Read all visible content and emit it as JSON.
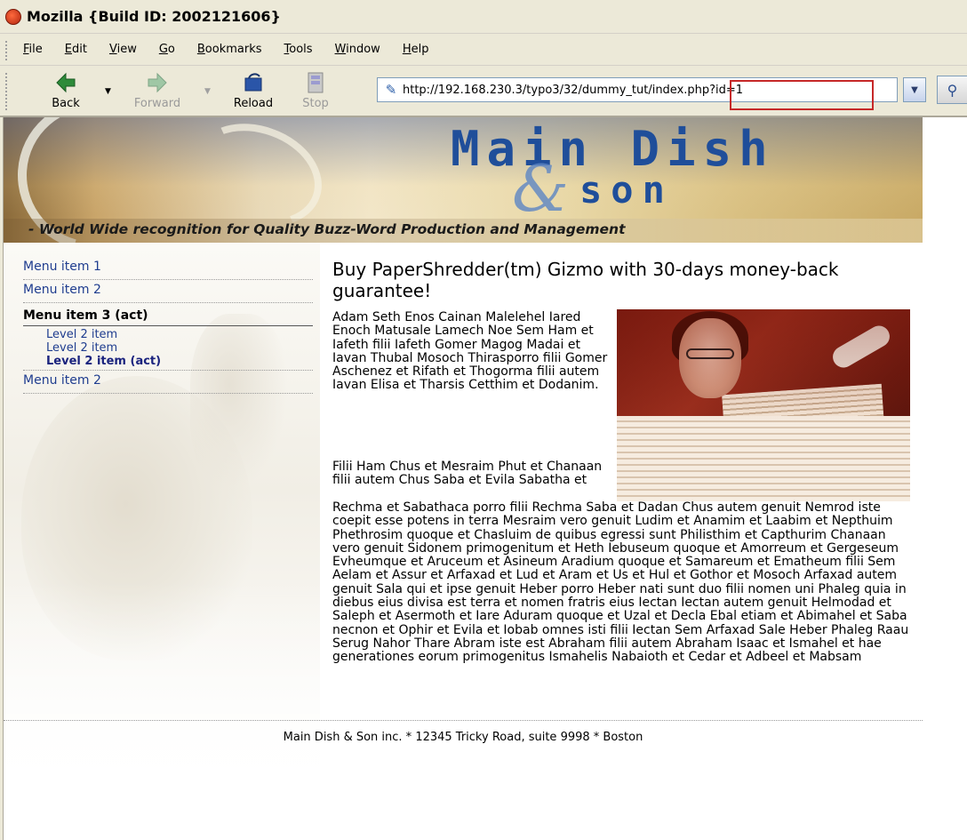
{
  "window": {
    "title": "Mozilla {Build ID: 2002121606}"
  },
  "menubar": {
    "items": [
      "File",
      "Edit",
      "View",
      "Go",
      "Bookmarks",
      "Tools",
      "Window",
      "Help"
    ]
  },
  "toolbar": {
    "back_label": "Back",
    "forward_label": "Forward",
    "reload_label": "Reload",
    "stop_label": "Stop",
    "url": "http://192.168.230.3/typo3/32/dummy_tut/index.php?id=1"
  },
  "banner": {
    "title_main": "Main Dish",
    "title_amp": "&",
    "title_son": "son",
    "tagline": "- World Wide recognition for Quality Buzz-Word Production and Management"
  },
  "menu": {
    "item1": "Menu item 1",
    "item2": "Menu item 2",
    "item3": "Menu item 3 (act)",
    "sub1": "Level 2 item",
    "sub2": "Level 2 item",
    "sub3": "Level 2 item (act)",
    "item4": "Menu item 2"
  },
  "article": {
    "heading": "Buy PaperShredder(tm) Gizmo with 30-days money-back guarantee!",
    "para1": "Adam Seth Enos Cainan Malelehel Iared Enoch Matusale Lamech Noe Sem Ham et Iafeth filii Iafeth Gomer Magog Madai et Iavan Thubal Mosoch Thirasporro filii Gomer Aschenez et Rifath et Thogorma filii autem Iavan Elisa et Tharsis Cetthim et Dodanim.",
    "para2_top": "Filii Ham Chus et Mesraim Phut et Chanaan filii autem Chus Saba et Evila Sabatha et",
    "para2_bottom": "Rechma et Sabathaca porro filii Rechma Saba et Dadan Chus autem genuit Nemrod iste coepit esse potens in terra Mesraim vero genuit Ludim et Anamim et Laabim et Nepthuim Phethrosim quoque et Chasluim de quibus egressi sunt Philisthim et Capthurim Chanaan vero genuit Sidonem primogenitum et Heth Iebuseum quoque et Amorreum et Gergeseum Evheumque et Aruceum et Asineum Aradium quoque et Samareum et Ematheum filii Sem Aelam et Assur et Arfaxad et Lud et Aram et Us et Hul et Gothor et Mosoch Arfaxad autem genuit Sala qui et ipse genuit Heber porro Heber nati sunt duo filii nomen uni Phaleg quia in diebus eius divisa est terra et nomen fratris eius Iectan Iectan autem genuit Helmodad et Saleph et Asermoth et Iare Aduram quoque et Uzal et Decla Ebal etiam et Abimahel et Saba necnon et Ophir et Evila et Iobab omnes isti filii Iectan Sem Arfaxad Sale Heber Phaleg Raau Serug Nahor Thare Abram iste est Abraham filii autem Abraham Isaac et Ismahel et hae generationes eorum primogenitus Ismahelis Nabaioth et Cedar et Adbeel et Mabsam"
  },
  "footer": {
    "text": "Main Dish & Son inc. * 12345 Tricky Road, suite 9998 * Boston"
  },
  "colors": {
    "menu_link": "#1f3d8f",
    "url_highlight": "#c62828",
    "banner_title": "#1f4e9a"
  }
}
